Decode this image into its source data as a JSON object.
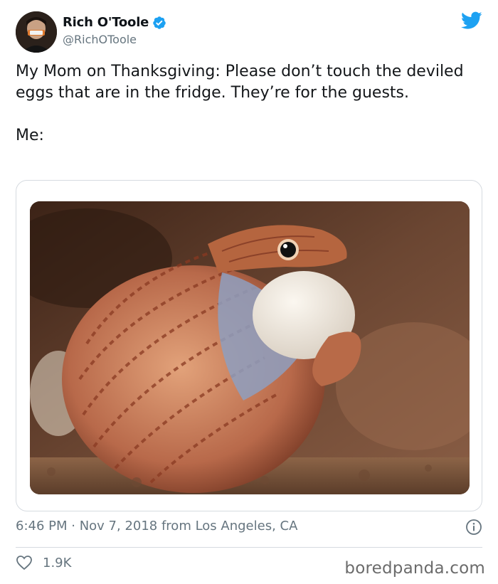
{
  "author": {
    "name": "Rich O'Toole",
    "handle": "@RichOToole",
    "verified": true,
    "avatar_icon": "avatar"
  },
  "tweet": {
    "text": "My Mom on Thanksgiving: Please don’t touch the deviled eggs that are in the fridge. They’re for the guests.\n\nMe:",
    "timestamp": "6:46 PM · Nov 7, 2018 from Los Angeles, CA",
    "likes": "1.9K"
  },
  "icons": {
    "brand": "twitter-bird-icon",
    "verified": "verified-badge-icon",
    "info": "info-icon",
    "like": "heart-icon"
  },
  "colors": {
    "brand_blue": "#1da1f2",
    "text": "#14171a",
    "secondary": "#66757f",
    "border": "#d6dbe0"
  },
  "watermark": "boredpanda.com"
}
